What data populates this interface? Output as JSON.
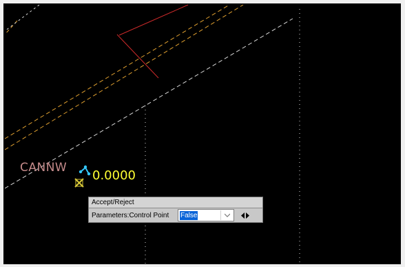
{
  "canvas": {
    "point_label": "CANNW",
    "elevation_value": "0.0000",
    "colors": {
      "background": "#000000",
      "red_line": "#cc2a2a",
      "orange_dashes": "#e0a030",
      "white_dashes": "#d8d8d8",
      "label_color": "#c58b8b",
      "value_color": "#ffff33",
      "grip_color": "#34c8ff",
      "marker_color": "#d8c838"
    }
  },
  "dialog": {
    "title": "Accept/Reject",
    "parameter_label": "Parameters:Control Point",
    "parameter_value": "False",
    "dropdown_icon": "chevron-down-icon",
    "nav_icon": "left-right-arrows-icon"
  }
}
